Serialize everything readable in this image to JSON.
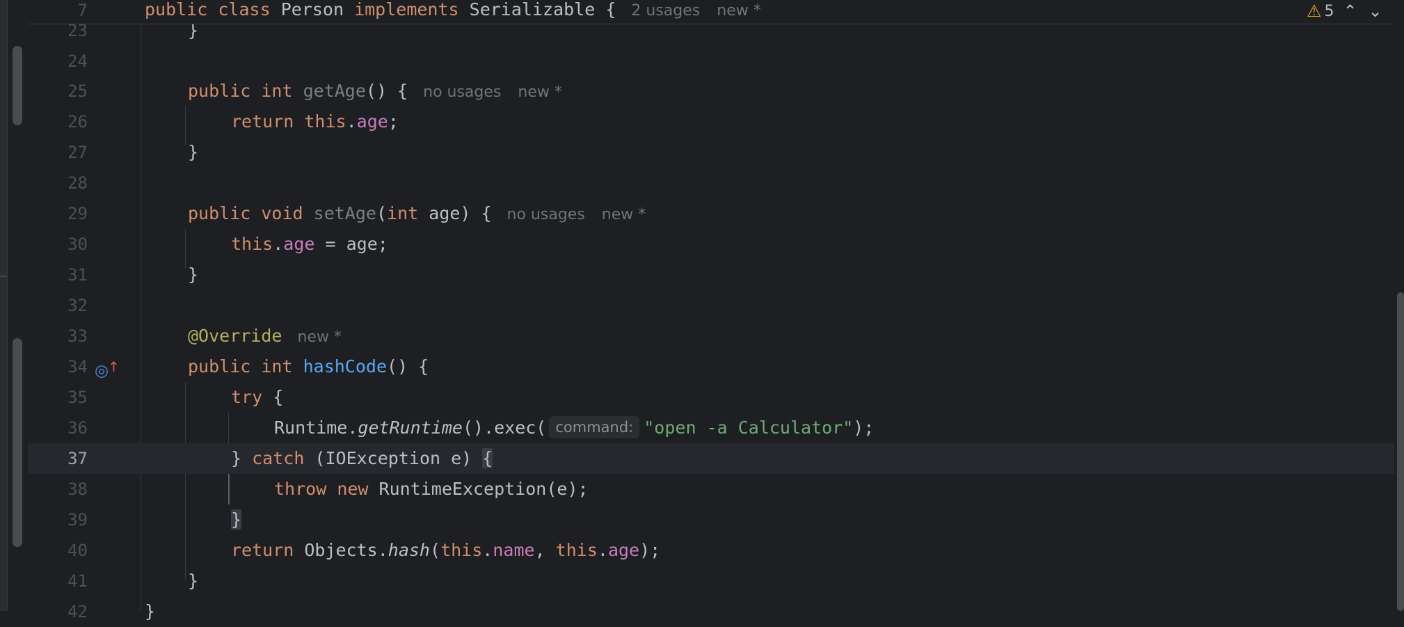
{
  "sticky_header": {
    "line_number": "7",
    "kw1": "public",
    "kw2": "class",
    "class_name": "Person",
    "kw3": "implements",
    "iface": "Serializable",
    "brace": "{",
    "usage_hint": "2 usages",
    "new_hint": "new *"
  },
  "inspection": {
    "warning_count": "5",
    "warning_icon": "warning-icon",
    "up_icon": "chevron-up-icon",
    "down_icon": "chevron-down-icon"
  },
  "lines": {
    "l23": {
      "num": "23",
      "brace": "}"
    },
    "l24": {
      "num": "24"
    },
    "l25": {
      "num": "25",
      "kw1": "public",
      "kw2": "int",
      "method": "getAge",
      "rest": "() {",
      "usage_hint": "no usages",
      "new_hint": "new *"
    },
    "l26": {
      "num": "26",
      "kw": "return",
      "this": "this",
      "dot": ".",
      "field": "age",
      "end": ";"
    },
    "l27": {
      "num": "27",
      "brace": "}"
    },
    "l28": {
      "num": "28"
    },
    "l29": {
      "num": "29",
      "kw1": "public",
      "kw2": "void",
      "method": "setAge",
      "p_open": "(",
      "p_type": "int",
      "p_rest": " age) {",
      "usage_hint": "no usages",
      "new_hint": "new *"
    },
    "l30": {
      "num": "30",
      "this": "this",
      "dot": ".",
      "field": "age",
      "rest": " = age;"
    },
    "l31": {
      "num": "31",
      "brace": "}"
    },
    "l32": {
      "num": "32"
    },
    "l33": {
      "num": "33",
      "annotation": "@Override",
      "new_hint": "new *"
    },
    "l34": {
      "num": "34",
      "kw1": "public",
      "kw2": "int",
      "method": "hashCode",
      "rest": "() {",
      "gutter_icon": "override-method-icon"
    },
    "l35": {
      "num": "35",
      "kw": "try",
      "rest": " {"
    },
    "l36": {
      "num": "36",
      "cls": "Runtime.",
      "call": "getRuntime",
      "mid": "().exec(",
      "param_hint": "command:",
      "str": "\"open -a Calculator\"",
      "end": ");"
    },
    "l37": {
      "num": "37",
      "close": "} ",
      "kw": "catch",
      "rest": " (IOException e) ",
      "brace": "{"
    },
    "l38": {
      "num": "38",
      "kw1": "throw",
      "kw2": "new",
      "rest": " RuntimeException(e);"
    },
    "l39": {
      "num": "39",
      "brace": "}"
    },
    "l40": {
      "num": "40",
      "kw": "return",
      "cls": " Objects.",
      "call": "hash",
      "p_open": "(",
      "this1": "this",
      "dot1": ".",
      "field1": "name",
      "comma": ", ",
      "this2": "this",
      "dot2": ".",
      "field2": "age",
      "end": ");"
    },
    "l41": {
      "num": "41",
      "brace": "}"
    },
    "l42": {
      "num": "42",
      "brace": "}"
    }
  }
}
